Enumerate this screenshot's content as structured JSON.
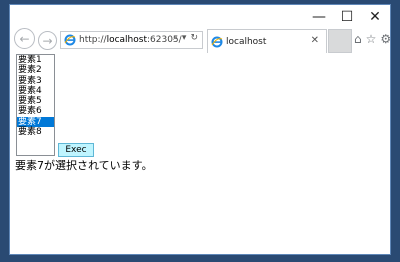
{
  "window": {
    "minimize": "—",
    "maximize": "☐",
    "close": "✕"
  },
  "nav": {
    "back": "←",
    "forward": "→",
    "address_prefix": "http://",
    "address_host": "localhost",
    "address_port": ":62305/",
    "search": "⌕",
    "dropdown": "▾",
    "refresh": "↻"
  },
  "tab": {
    "title": "localhost",
    "close": "✕"
  },
  "tools": {
    "home": "⌂",
    "favorites": "☆",
    "settings": "⚙"
  },
  "list": {
    "items": [
      "要素1",
      "要素2",
      "要素3",
      "要素4",
      "要素5",
      "要素6",
      "要素7",
      "要素8"
    ],
    "selected_index": 6
  },
  "exec_button": "Exec",
  "message": "要素7が選択されています。",
  "colors": {
    "selection": "#0078d7",
    "exec_bg": "#bff5ff"
  }
}
